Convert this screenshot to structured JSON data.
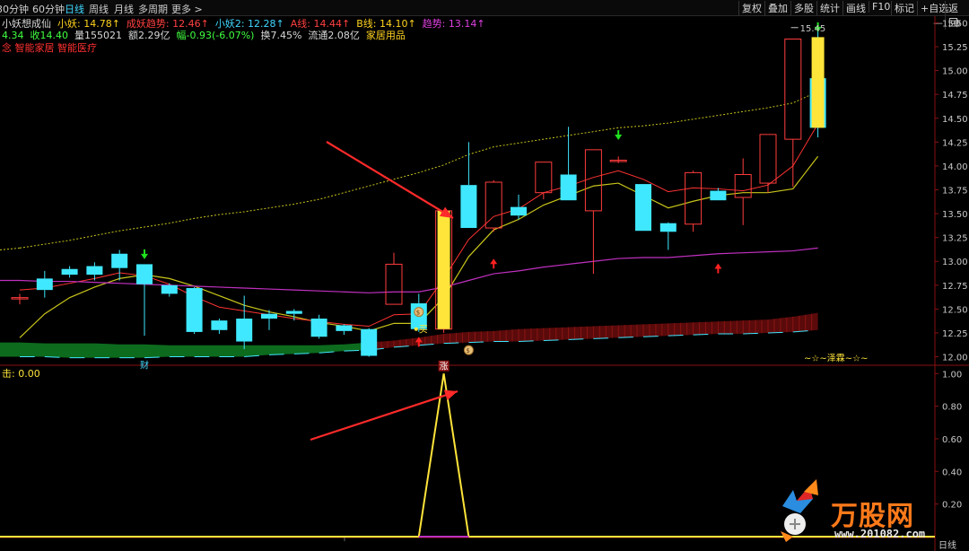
{
  "periods": [
    {
      "label": "30分钟",
      "active": false
    },
    {
      "label": "60分钟",
      "active": false
    },
    {
      "label": "日线",
      "active": true
    },
    {
      "label": "周线",
      "active": false
    },
    {
      "label": "月线",
      "active": false
    },
    {
      "label": "多周期",
      "active": false
    },
    {
      "label": "更多 >",
      "active": false
    }
  ],
  "toolbar": [
    "复权",
    "叠加",
    "多股",
    "统计",
    "画线",
    "F10",
    "标记",
    "+自选",
    "返回"
  ],
  "window_controls": {
    "minimize": "—",
    "close": "⊗"
  },
  "header": {
    "line1": [
      {
        "text": "小妖想成仙",
        "color": "#d8d8d8"
      },
      {
        "text": "小妖: 14.78↑",
        "color": "#ffd21f"
      },
      {
        "text": "成妖趋势: 12.46↑",
        "color": "#ff4040"
      },
      {
        "text": "小妖2: 12.28↑",
        "color": "#3fd7ff"
      },
      {
        "text": "A线: 14.44↑",
        "color": "#ff4040"
      },
      {
        "text": "B线: 14.10↑",
        "color": "#ffd21f"
      },
      {
        "text": "趋势: 13.14↑",
        "color": "#e040e0"
      }
    ],
    "line2": [
      {
        "text": "4.34",
        "color": "#40ff40"
      },
      {
        "text": "收14.40",
        "color": "#40ff40"
      },
      {
        "text": "量155021",
        "color": "#d8d8d8"
      },
      {
        "text": "额2.29亿",
        "color": "#d8d8d8"
      },
      {
        "text": "幅-0.93(-6.07%)",
        "color": "#40ff40"
      },
      {
        "text": "换7.45%",
        "color": "#d8d8d8"
      },
      {
        "text": "流通2.08亿",
        "color": "#d8d8d8"
      },
      {
        "text": "家居用品",
        "color": "#ffd21f"
      }
    ],
    "line3": [
      {
        "text": "念 智能家居 智能医疗",
        "color": "#ff3030"
      }
    ]
  },
  "lower_panel_label": "击: 0.00",
  "annotations": {
    "high_price": "15.45",
    "signature": "~☆~泽霖~☆~",
    "cai_marker": "财",
    "zhang_marker": "涨",
    "buy_marker": "买",
    "bottom_tag": "日线"
  },
  "watermark": {
    "text": "万股网",
    "url": "www.201082.com"
  },
  "colors": {
    "up": "#ff3c3c",
    "down": "#3fe8ff",
    "limit_up": "#ffe43a",
    "ma_yellow": "#c8c41a",
    "ma_red": "#ff3333",
    "ma_purple": "#c030c0",
    "ma_dotted": "#c8c41a",
    "arrow": "#ff2020",
    "indicator": "#ffe43a"
  },
  "chart_data": {
    "type": "candlestick",
    "price_axis": {
      "ticks": [
        12.0,
        12.25,
        12.5,
        12.75,
        13.0,
        13.25,
        13.5,
        13.75,
        14.0,
        14.25,
        14.5,
        14.75,
        15.0,
        15.25,
        15.5
      ],
      "range": [
        11.93,
        15.57
      ]
    },
    "indicator_axis": {
      "ticks": [
        0.2,
        0.4,
        0.6,
        0.8,
        1.0
      ],
      "range": [
        0,
        1.04
      ]
    },
    "candles": [
      {
        "o": 12.62,
        "h": 12.66,
        "l": 12.55,
        "c": 12.62
      },
      {
        "o": 12.82,
        "h": 12.9,
        "l": 12.62,
        "c": 12.7
      },
      {
        "o": 12.92,
        "h": 12.95,
        "l": 12.83,
        "c": 12.86
      },
      {
        "o": 12.95,
        "h": 12.99,
        "l": 12.8,
        "c": 12.86
      },
      {
        "o": 13.08,
        "h": 13.12,
        "l": 12.8,
        "c": 12.93
      },
      {
        "o": 12.97,
        "h": 12.97,
        "l": 12.22,
        "c": 12.76
      },
      {
        "o": 12.75,
        "h": 12.77,
        "l": 12.63,
        "c": 12.66
      },
      {
        "o": 12.72,
        "h": 12.73,
        "l": 12.24,
        "c": 12.26
      },
      {
        "o": 12.38,
        "h": 12.4,
        "l": 12.24,
        "c": 12.28
      },
      {
        "o": 12.4,
        "h": 12.64,
        "l": 12.08,
        "c": 12.16
      },
      {
        "o": 12.45,
        "h": 12.49,
        "l": 12.28,
        "c": 12.4
      },
      {
        "o": 12.48,
        "h": 12.5,
        "l": 12.38,
        "c": 12.45
      },
      {
        "o": 12.4,
        "h": 12.44,
        "l": 12.19,
        "c": 12.21
      },
      {
        "o": 12.33,
        "h": 12.34,
        "l": 12.23,
        "c": 12.27
      },
      {
        "o": 12.29,
        "h": 12.3,
        "l": 12.0,
        "c": 12.01
      },
      {
        "o": 12.55,
        "h": 13.09,
        "l": 12.55,
        "c": 12.97
      },
      {
        "o": 12.56,
        "h": 12.66,
        "l": 12.26,
        "c": 12.29
      },
      {
        "o": 12.29,
        "h": 13.53,
        "l": 12.25,
        "c": 13.53
      },
      {
        "o": 13.8,
        "h": 14.25,
        "l": 13.35,
        "c": 13.35
      },
      {
        "o": 13.35,
        "h": 13.85,
        "l": 13.31,
        "c": 13.83
      },
      {
        "o": 13.57,
        "h": 13.7,
        "l": 13.44,
        "c": 13.48
      },
      {
        "o": 13.72,
        "h": 14.04,
        "l": 13.65,
        "c": 14.04
      },
      {
        "o": 13.91,
        "h": 14.41,
        "l": 13.64,
        "c": 13.64
      },
      {
        "o": 13.53,
        "h": 14.17,
        "l": 12.87,
        "c": 14.17
      },
      {
        "o": 14.06,
        "h": 14.1,
        "l": 14.03,
        "c": 14.06
      },
      {
        "o": 13.81,
        "h": 13.81,
        "l": 13.32,
        "c": 13.32
      },
      {
        "o": 13.4,
        "h": 13.41,
        "l": 13.12,
        "c": 13.31
      },
      {
        "o": 13.39,
        "h": 13.95,
        "l": 13.31,
        "c": 13.93
      },
      {
        "o": 13.74,
        "h": 13.77,
        "l": 13.64,
        "c": 13.64
      },
      {
        "o": 13.67,
        "h": 14.08,
        "l": 13.38,
        "c": 13.91
      },
      {
        "o": 13.82,
        "h": 14.33,
        "l": 13.72,
        "c": 14.33
      },
      {
        "o": 14.28,
        "h": 15.3,
        "l": 13.78,
        "c": 15.33
      },
      {
        "o": 14.92,
        "h": 15.45,
        "l": 14.3,
        "c": 14.4
      }
    ],
    "candle_limit_up_indices": [
      17,
      32
    ],
    "limit_up_overlay": [
      {
        "index": 17,
        "o": 12.29,
        "c": 13.53
      },
      {
        "index": 32,
        "o": 14.4,
        "c": 15.35
      }
    ],
    "series": [
      {
        "name": "小妖",
        "values": [
          12.2,
          12.45,
          12.62,
          12.73,
          12.82,
          12.86,
          12.82,
          12.74,
          12.64,
          12.54,
          12.47,
          12.42,
          12.36,
          12.32,
          12.27,
          12.35,
          12.35,
          12.62,
          13.05,
          13.33,
          13.44,
          13.59,
          13.69,
          13.79,
          13.82,
          13.69,
          13.56,
          13.63,
          13.69,
          13.72,
          13.72,
          13.76,
          14.1
        ]
      },
      {
        "name": "A线",
        "values": [
          12.7,
          12.72,
          12.77,
          12.82,
          12.88,
          12.85,
          12.76,
          12.63,
          12.52,
          12.48,
          12.44,
          12.4,
          12.37,
          12.34,
          12.32,
          12.44,
          12.45,
          12.82,
          13.23,
          13.47,
          13.55,
          13.72,
          13.79,
          13.88,
          13.95,
          13.86,
          13.73,
          13.77,
          13.76,
          13.74,
          13.8,
          14.0,
          14.44
        ]
      },
      {
        "name": "趋势",
        "values": [
          12.8,
          12.79,
          12.79,
          12.78,
          12.77,
          12.76,
          12.75,
          12.74,
          12.73,
          12.72,
          12.71,
          12.7,
          12.69,
          12.68,
          12.67,
          12.68,
          12.68,
          12.73,
          12.8,
          12.87,
          12.9,
          12.94,
          12.97,
          13.0,
          13.03,
          13.04,
          13.04,
          13.06,
          13.08,
          13.09,
          13.1,
          13.11,
          13.14
        ]
      },
      {
        "name": "成妖趋势",
        "values": [
          13.14,
          13.18,
          13.22,
          13.27,
          13.32,
          13.36,
          13.4,
          13.45,
          13.49,
          13.52,
          13.56,
          13.6,
          13.65,
          13.72,
          13.79,
          13.86,
          13.93,
          14.01,
          14.12,
          14.2,
          14.24,
          14.28,
          14.32,
          14.36,
          14.4,
          14.42,
          14.45,
          14.49,
          14.53,
          14.57,
          14.61,
          14.66,
          14.78
        ]
      }
    ],
    "band": {
      "top": [
        12.15,
        12.14,
        12.14,
        12.14,
        12.13,
        12.13,
        12.12,
        12.12,
        12.12,
        12.12,
        12.12,
        12.12,
        12.12,
        12.13,
        12.15,
        12.17,
        12.2,
        12.24,
        12.26,
        12.27,
        12.29,
        12.3,
        12.31,
        12.32,
        12.33,
        12.34,
        12.35,
        12.36,
        12.37,
        12.38,
        12.39,
        12.42,
        12.46
      ],
      "bottom": [
        12.0,
        12.0,
        11.99,
        11.99,
        11.99,
        11.99,
        12.0,
        12.0,
        12.0,
        12.0,
        12.02,
        12.03,
        12.04,
        12.06,
        12.07,
        12.1,
        12.12,
        12.14,
        12.15,
        12.16,
        12.16,
        12.17,
        12.18,
        12.19,
        12.2,
        12.21,
        12.22,
        12.23,
        12.24,
        12.24,
        12.25,
        12.26,
        12.28
      ]
    },
    "indicator": {
      "name": "击",
      "values_by_index": {
        "16": 0,
        "17": 1,
        "18": 0
      }
    }
  }
}
